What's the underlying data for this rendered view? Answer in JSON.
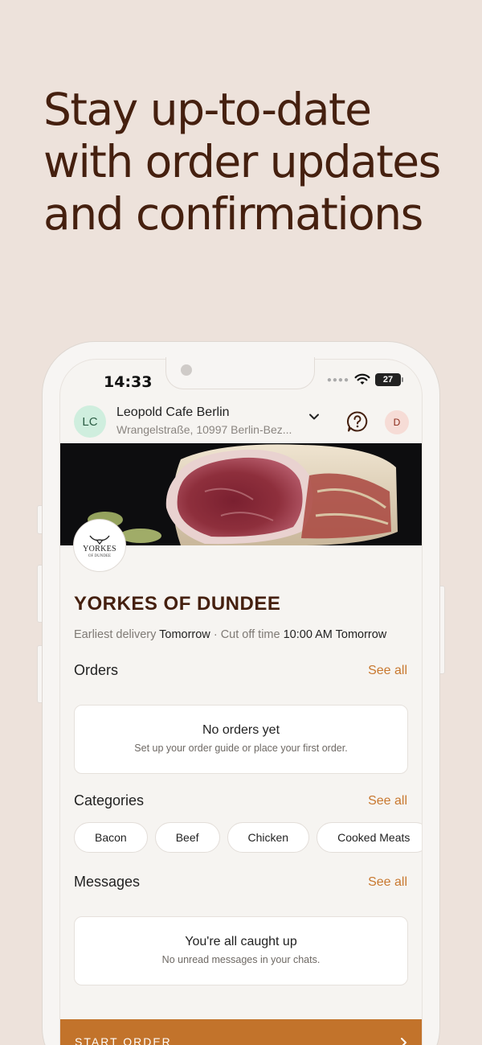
{
  "headline": {
    "line1": "Stay up-to-date",
    "line2": "with order updates",
    "line3": "and confirmations"
  },
  "status_bar": {
    "time": "14:33",
    "battery": "27"
  },
  "header": {
    "avatar_initials": "LC",
    "location_name": "Leopold Cafe Berlin",
    "location_address": "Wrangelstraße, 10997 Berlin-Bez...",
    "user_initial": "D",
    "icons": [
      "chevron-down-icon",
      "help-icon"
    ]
  },
  "store": {
    "logo_text": "YORKES",
    "logo_subtext": "OF DUNDEE",
    "name": "YORKES OF DUNDEE",
    "earliest_label": "Earliest delivery",
    "earliest_value": "Tomorrow",
    "separator": "·",
    "cutoff_label": "Cut off time",
    "cutoff_value": "10:00 AM Tomorrow"
  },
  "orders": {
    "title": "Orders",
    "see_all": "See all",
    "empty_title": "No orders yet",
    "empty_sub": "Set up your order guide or place your first order."
  },
  "categories": {
    "title": "Categories",
    "see_all": "See all",
    "items": [
      "Bacon",
      "Beef",
      "Chicken",
      "Cooked Meats"
    ]
  },
  "messages": {
    "title": "Messages",
    "see_all": "See all",
    "empty_title": "You're all caught up",
    "empty_sub": "No unread messages in your chats."
  },
  "cta": {
    "label": "START ORDER"
  },
  "colors": {
    "background": "#ede2db",
    "headline": "#45200f",
    "accent": "#c8782f",
    "cta": "#c2732b"
  }
}
